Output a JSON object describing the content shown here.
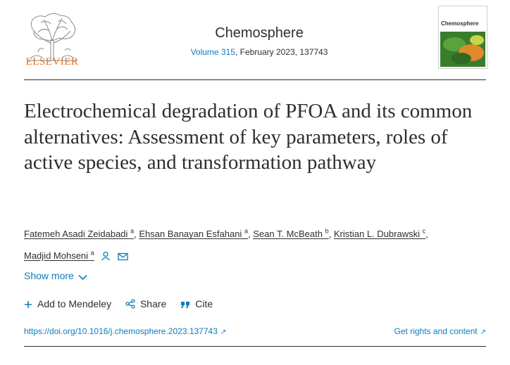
{
  "header": {
    "publisher": "ELSEVIER",
    "journal": "Chemosphere",
    "volume_link": "Volume 315",
    "volume_rest": ", February 2023, 137743",
    "cover_title": "Chemosphere"
  },
  "article": {
    "title": "Electrochemical degradation of PFOA and its common alternatives: Assessment of key parameters, roles of active species, and transformation pathway"
  },
  "authors": [
    {
      "name": "Fatemeh Asadi Zeidabadi",
      "aff": "a"
    },
    {
      "name": "Ehsan Banayan Esfahani",
      "aff": "a"
    },
    {
      "name": "Sean T. McBeath",
      "aff": "b"
    },
    {
      "name": "Kristian L. Dubrawski",
      "aff": "c"
    },
    {
      "name": "Madjid Mohseni",
      "aff": "a"
    }
  ],
  "separator": ",",
  "show_more": "Show more",
  "actions": {
    "mendeley": "Add to Mendeley",
    "share": "Share",
    "cite": "Cite"
  },
  "links": {
    "doi": "https://doi.org/10.1016/j.chemosphere.2023.137743",
    "rights": "Get rights and content",
    "external_glyph": "↗"
  },
  "colors": {
    "link": "#0c7dbb",
    "elsevier_orange": "#e9711c",
    "text": "#2e2e2e"
  },
  "icons": [
    "elsevier-tree-logo",
    "person-icon",
    "envelope-icon",
    "chevron-down-icon",
    "plus-icon",
    "share-icon",
    "quote-icon",
    "external-link-icon"
  ]
}
